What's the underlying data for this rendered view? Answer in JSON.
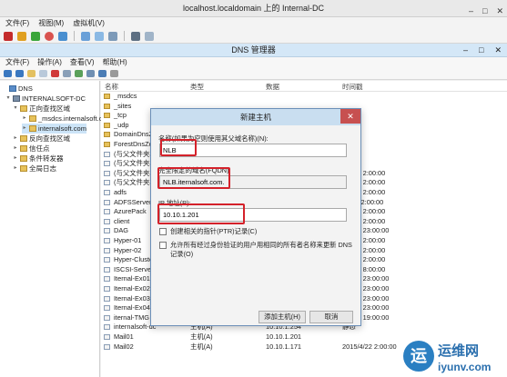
{
  "vm": {
    "title": "localhost.localdomain 上的 Internal-DC",
    "menu": [
      "文件(F)",
      "视图(M)",
      "虚拟机(V)"
    ],
    "win_buttons": [
      "–",
      "□",
      "✕"
    ]
  },
  "dns": {
    "title": "DNS 管理器",
    "menu": [
      "文件(F)",
      "操作(A)",
      "查看(V)",
      "帮助(H)"
    ],
    "win_buttons": [
      "–",
      "□",
      "✕"
    ]
  },
  "tree": [
    {
      "label": "DNS",
      "icon": "dns-icon",
      "arrow": ""
    },
    {
      "label": "INTERNALSOFT-DC",
      "icon": "server-icon",
      "arrow": "▾"
    },
    {
      "label": "正向查找区域",
      "icon": "folder-icon",
      "arrow": "▾"
    },
    {
      "label": "_msdcs.internalsoft.c",
      "icon": "folder-icon",
      "arrow": "▸"
    },
    {
      "label": "internalsoft.com",
      "icon": "folder-icon",
      "arrow": "▸"
    },
    {
      "label": "反向查找区域",
      "icon": "folder-icon",
      "arrow": "▸"
    },
    {
      "label": "信任点",
      "icon": "folder-icon",
      "arrow": "▸"
    },
    {
      "label": "条件转发器",
      "icon": "folder-icon",
      "arrow": "▸"
    },
    {
      "label": "全局日志",
      "icon": "folder-icon",
      "arrow": "▸"
    }
  ],
  "list": {
    "columns": [
      "名称",
      "类型",
      "数据",
      "时间戳"
    ],
    "rows": [
      {
        "name": "_msdcs",
        "type": "",
        "data": "",
        "time": "",
        "icon": "folder"
      },
      {
        "name": "_sites",
        "type": "",
        "data": "",
        "time": "",
        "icon": "folder"
      },
      {
        "name": "_tcp",
        "type": "",
        "data": "",
        "time": "",
        "icon": "folder"
      },
      {
        "name": "_udp",
        "type": "",
        "data": "",
        "time": "",
        "icon": "folder"
      },
      {
        "name": "DomainDnsZo",
        "type": "",
        "data": "",
        "time": "",
        "icon": "folder"
      },
      {
        "name": "ForestDnsZone",
        "type": "",
        "data": "",
        "time": "",
        "icon": "folder"
      },
      {
        "name": "(与父文件夹相同",
        "type": "",
        "data": "",
        "time": "",
        "icon": "rec"
      },
      {
        "name": "(与父文件夹相同",
        "type": "",
        "data": "",
        "time": "",
        "icon": "rec"
      },
      {
        "name": "(与父文件夹相同",
        "type": "",
        "data": "",
        "time": "5/4/16 2:00:00",
        "icon": "rec"
      },
      {
        "name": "(与父文件夹相同",
        "type": "",
        "data": "",
        "time": "5/4/16 2:00:00",
        "icon": "rec"
      },
      {
        "name": "adfs",
        "type": "",
        "data": "",
        "time": "5/4/16 2:00:00",
        "icon": "rec"
      },
      {
        "name": "ADFSServer",
        "type": "",
        "data": "",
        "time": "2/26 22:00:00",
        "icon": "rec"
      },
      {
        "name": "AzurePack",
        "type": "",
        "data": "",
        "time": "5/4/16 2:00:00",
        "icon": "rec"
      },
      {
        "name": "client",
        "type": "",
        "data": "",
        "time": "5/4/16 2:00:00",
        "icon": "rec"
      },
      {
        "name": "DAG",
        "type": "",
        "data": "",
        "time": "5/4/20 23:00:00",
        "icon": "rec"
      },
      {
        "name": "Hyper-01",
        "type": "",
        "data": "",
        "time": "5/4/16 2:00:00",
        "icon": "rec"
      },
      {
        "name": "Hyper-02",
        "type": "",
        "data": "",
        "time": "5/4/16 2:00:00",
        "icon": "rec"
      },
      {
        "name": "Hyper-Cluster",
        "type": "",
        "data": "",
        "time": "5/4/16 2:00:00",
        "icon": "rec"
      },
      {
        "name": "ISCSI-Server",
        "type": "",
        "data": "",
        "time": "5/4/19 8:00:00",
        "icon": "rec"
      },
      {
        "name": "Iternal-Ex01",
        "type": "",
        "data": "",
        "time": "5/4/20 23:00:00",
        "icon": "rec"
      },
      {
        "name": "Iternal-Ex02",
        "type": "",
        "data": "",
        "time": "5/4/20 23:00:00",
        "icon": "rec"
      },
      {
        "name": "Iternal-Ex03",
        "type": "",
        "data": "",
        "time": "5/4/20 23:00:00",
        "icon": "rec"
      },
      {
        "name": "Iternal-Ex04",
        "type": "",
        "data": "",
        "time": "5/4/20 23:00:00",
        "icon": "rec"
      },
      {
        "name": "iternal-TMG",
        "type": "",
        "data": "",
        "time": "5/4/17 19:00:00",
        "icon": "rec"
      },
      {
        "name": "internalsoft-dc",
        "type": "主机(A)",
        "data": "10.10.1.254",
        "time": "静态",
        "icon": "rec"
      },
      {
        "name": "Mail01",
        "type": "主机(A)",
        "data": "10.10.1.201",
        "time": "",
        "icon": "rec"
      },
      {
        "name": "Mail02",
        "type": "主机(A)",
        "data": "10.10.1.171",
        "time": "2015/4/22 2:00:00",
        "icon": "rec"
      }
    ]
  },
  "dialog": {
    "title": "新建主机",
    "name_label": "名称(如果为空则使用其父域名称)(N):",
    "name_value": "NLB",
    "fqdn_label": "完全限定的域名(FQDN):",
    "fqdn_value": "NLB.iternalsoft.com.",
    "ip_label": "IP 地址(P):",
    "ip_value": "10.10.1.201",
    "ptr_label": "创建相关的指针(PTR)记录(C)",
    "auth_label": "允许所有经过身份验证的用户用相同的所有者名称来更新 DNS 记录(O)",
    "add_button": "添加主机(H)",
    "cancel_button": "取消",
    "close": "✕"
  },
  "watermark": {
    "logo_char": "运",
    "site_name": "运维网",
    "url": "iyunv.com"
  },
  "colors": {
    "highlight_red": "#d4212a",
    "dialog_title": "#c9def0",
    "dns_title": "#d4e7f7"
  }
}
